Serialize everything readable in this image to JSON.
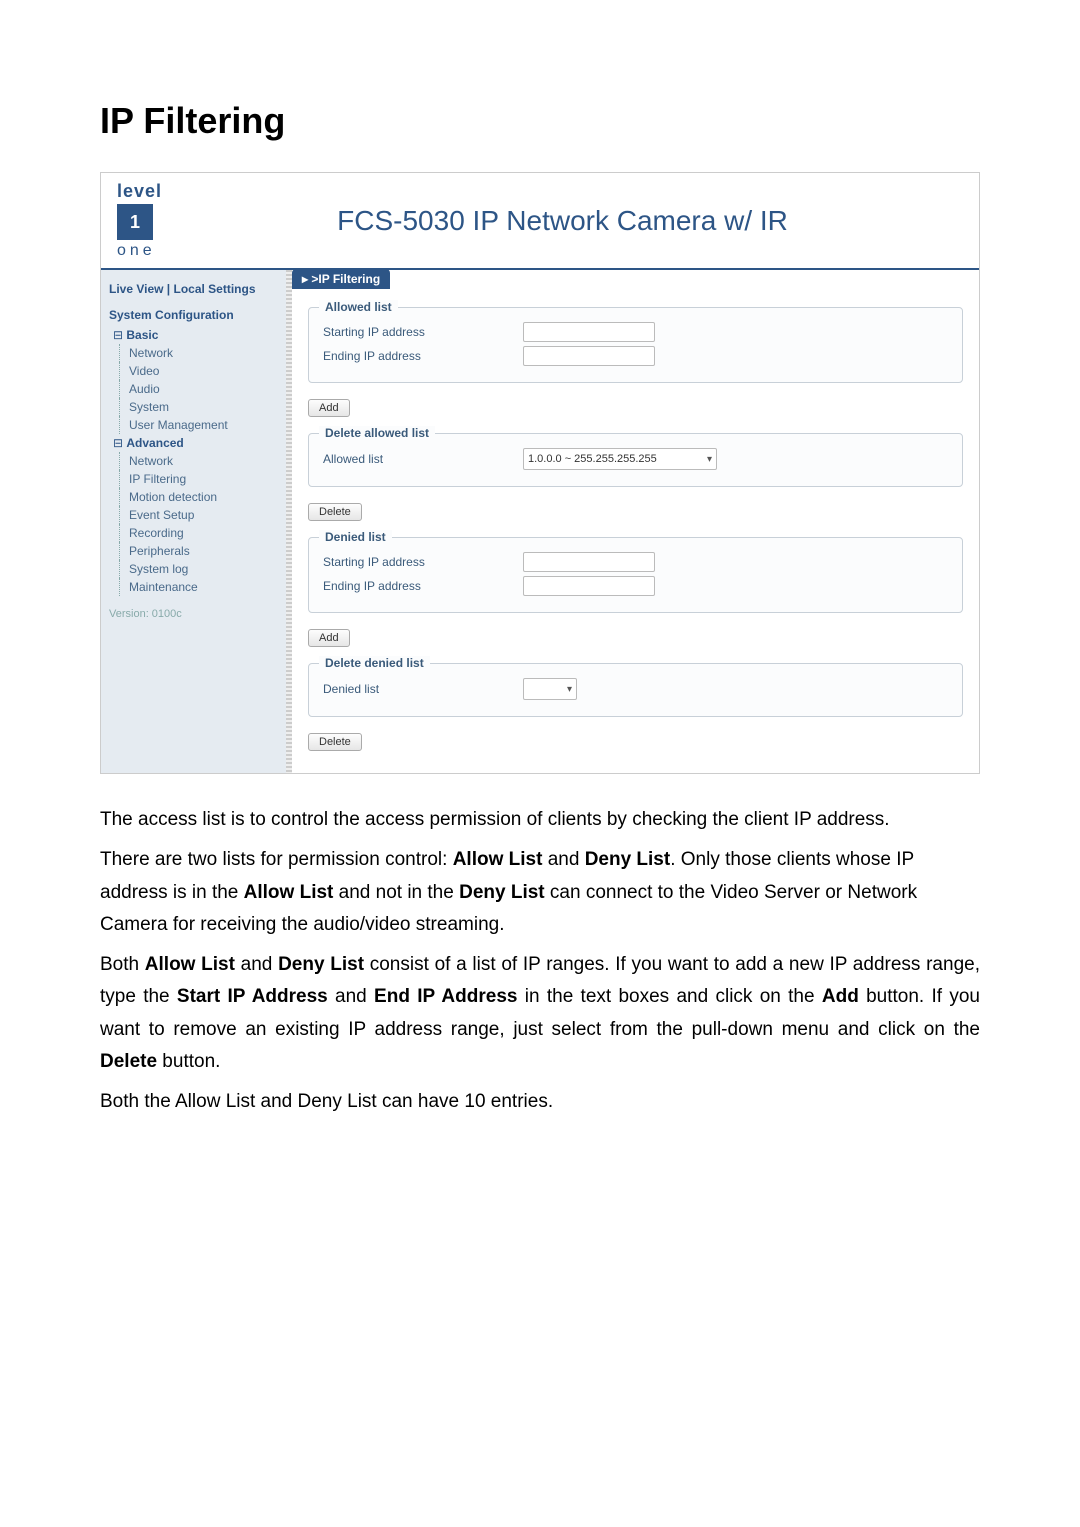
{
  "page": {
    "heading": "IP Filtering"
  },
  "logo": {
    "top": "level",
    "bottom": "one"
  },
  "header": {
    "title": "FCS-5030 IP Network Camera w/ IR"
  },
  "sidebar": {
    "live_view": "Live View | Local Settings",
    "sys_conf": "System Configuration",
    "basic": "Basic",
    "basic_items": [
      "Network",
      "Video",
      "Audio",
      "System",
      "User Management"
    ],
    "advanced": "Advanced",
    "advanced_items": [
      "Network",
      "IP Filtering",
      "Motion detection",
      "Event Setup",
      "Recording",
      "Peripherals",
      "System log",
      "Maintenance"
    ],
    "version": "Version: 0100c"
  },
  "main": {
    "tab": "IP Filtering",
    "allowed": {
      "legend": "Allowed list",
      "start_label": "Starting IP address",
      "end_label": "Ending IP address",
      "add_btn": "Add"
    },
    "delete_allowed": {
      "legend": "Delete allowed list",
      "list_label": "Allowed list",
      "select_value": "1.0.0.0 ~ 255.255.255.255",
      "delete_btn": "Delete"
    },
    "denied": {
      "legend": "Denied list",
      "start_label": "Starting IP address",
      "end_label": "Ending IP address",
      "add_btn": "Add"
    },
    "delete_denied": {
      "legend": "Delete denied list",
      "list_label": "Denied list",
      "select_value": "",
      "delete_btn": "Delete"
    }
  },
  "doc": {
    "p1": "The access list is to control the access permission of clients by checking the client IP address.",
    "p2_a": "There are two lists for permission control: ",
    "p2_b": "Allow List",
    "p2_c": " and ",
    "p2_d": "Deny List",
    "p2_e": ". Only those clients whose IP address is in the ",
    "p2_f": "Allow List",
    "p2_g": " and not in the ",
    "p2_h": "Deny List",
    "p2_i": " can connect to the Video Server or Network Camera for receiving the audio/video streaming.",
    "p3_a": "Both ",
    "p3_b": "Allow List",
    "p3_c": " and ",
    "p3_d": "Deny List",
    "p3_e": " consist of a list of IP ranges. If you want to add a new IP address range, type the ",
    "p3_f": "Start IP Address",
    "p3_g": " and ",
    "p3_h": "End IP Address",
    "p3_i": " in the text boxes and click on the ",
    "p3_j": "Add",
    "p3_k": " button. If you want to remove an existing IP address range, just select from the pull-down menu and click on the ",
    "p3_l": "Delete",
    "p3_m": " button.",
    "p4": "Both the Allow List and Deny List can have 10 entries."
  }
}
